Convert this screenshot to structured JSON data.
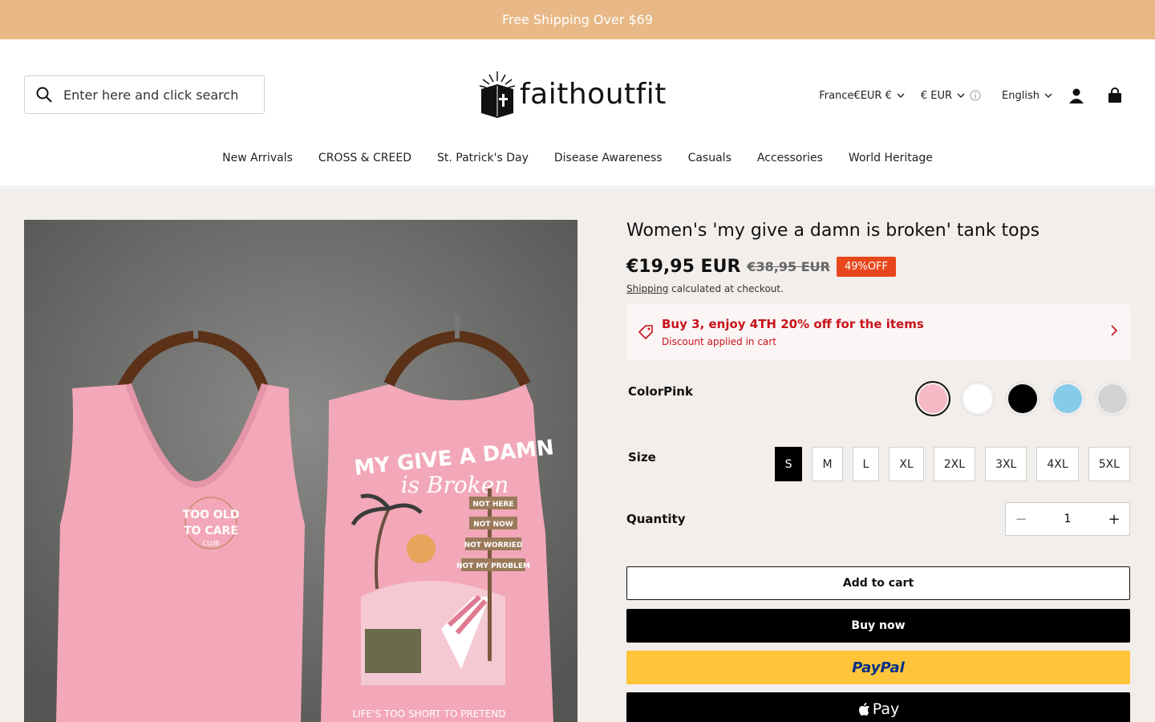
{
  "announcement": "Free Shipping Over $69",
  "search": {
    "placeholder": "Enter here and click search"
  },
  "logo": {
    "text": "faithoutfit"
  },
  "header": {
    "country": "France€EUR €",
    "currency": "€ EUR",
    "language": "English"
  },
  "nav": [
    "New Arrivals",
    "CROSS & CREED",
    "St. Patrick's Day",
    "Disease Awareness",
    "Casuals",
    "Accessories",
    "World Heritage"
  ],
  "product": {
    "title": "Women's 'my give a damn is broken' tank tops",
    "price": "€19,95 EUR",
    "old_price": "€38,95 EUR",
    "discount_badge": "49%OFF",
    "shipping_link": "Shipping",
    "shipping_text": " calculated at checkout.",
    "promo_title": "Buy 3, enjoy 4TH 20% off for the items",
    "promo_sub": "Discount applied in cart",
    "color_label": "Color",
    "color_value": "Pink",
    "colors": [
      {
        "name": "Pink",
        "hex": "#f8b9c6",
        "selected": true
      },
      {
        "name": "White",
        "hex": "#ffffff",
        "selected": false
      },
      {
        "name": "Black",
        "hex": "#000000",
        "selected": false
      },
      {
        "name": "Light Blue",
        "hex": "#86ccea",
        "selected": false
      },
      {
        "name": "Light Gray",
        "hex": "#d3d3d3",
        "selected": false
      }
    ],
    "size_label": "Size",
    "sizes": [
      "S",
      "M",
      "L",
      "XL",
      "2XL",
      "3XL",
      "4XL",
      "5XL"
    ],
    "selected_size": "S",
    "quantity_label": "Quantity",
    "quantity": "1",
    "add_to_cart": "Add to cart",
    "buy_now": "Buy now",
    "paypal": "PayPal",
    "apple_pay": "Pay"
  },
  "image": {
    "front_print": [
      "TOO OLD",
      "TO CARE",
      "CLUB"
    ],
    "back_headline": "MY GIVE A DAMN",
    "back_sub": "is Broken",
    "signs": [
      "NOT HERE",
      "NOT NOW",
      "NOT WORRIED",
      "NOT MY PROBLEM"
    ],
    "tagline": "LIFE'S TOO SHORT TO PRETEND"
  },
  "colors": {
    "announce_bg": "#e8b886",
    "badge": "#e8461b",
    "promo": "#c8121b",
    "paypal": "#ffc439",
    "page_bg": "#f2eeeb"
  }
}
